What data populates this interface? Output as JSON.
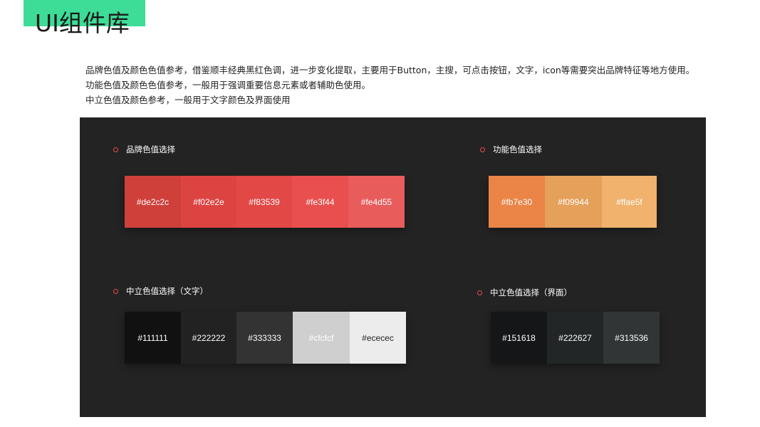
{
  "header": {
    "title": "UI组件库"
  },
  "description": [
    "品牌色值及颜色色值参考，借鉴顺丰经典黑红色调，进一步变化提取，主要用于Button，主搜，可点击按钮，文字，icon等需要突出品牌特征等地方使用。",
    "功能色值及颜色色值参考，一般用于强调重要信息元素或者辅助色使用。",
    "中立色值及颜色参考，一般用于文字颜色及界面使用"
  ],
  "accent_color": "#3ddc97",
  "panel_color": "#232323",
  "sections": {
    "brand": {
      "label": "品牌色值选择",
      "swatches": [
        {
          "label": "#de2c2c",
          "color": "#cf403b",
          "text_color": "#ffffff"
        },
        {
          "label": "#f02e2e",
          "color": "#dc4442",
          "text_color": "#ffffff"
        },
        {
          "label": "#f83539",
          "color": "#e14846",
          "text_color": "#ffffff"
        },
        {
          "label": "#fe3f44",
          "color": "#e84f4e",
          "text_color": "#ffffff"
        },
        {
          "label": "#fe4d55",
          "color": "#e95c5c",
          "text_color": "#ffffff"
        }
      ]
    },
    "function": {
      "label": "功能色值选择",
      "swatches": [
        {
          "label": "#fb7e30",
          "color": "#ea8447",
          "text_color": "#ffffff"
        },
        {
          "label": "#f09944",
          "color": "#e5a05a",
          "text_color": "#ffffff"
        },
        {
          "label": "#ffae5f",
          "color": "#f0b26d",
          "text_color": "#ffffff"
        }
      ]
    },
    "neutral_text": {
      "label": "中立色值选择（文字）",
      "swatches": [
        {
          "label": "#111111",
          "color": "#111111",
          "text_color": "#ffffff"
        },
        {
          "label": "#222222",
          "color": "#222222",
          "text_color": "#ffffff"
        },
        {
          "label": "#333333",
          "color": "#333333",
          "text_color": "#ffffff"
        },
        {
          "label": "#cfcfcf",
          "color": "#cfcfcf",
          "text_color": "#ffffff"
        },
        {
          "label": "#ececec",
          "color": "#ececec",
          "text_color": "#222222"
        }
      ]
    },
    "neutral_ui": {
      "label": "中立色值选择（界面）",
      "swatches": [
        {
          "label": "#151618",
          "color": "#151618",
          "text_color": "#ffffff"
        },
        {
          "label": "#222627",
          "color": "#222627",
          "text_color": "#ffffff"
        },
        {
          "label": "#313536",
          "color": "#313536",
          "text_color": "#ffffff"
        }
      ]
    }
  }
}
